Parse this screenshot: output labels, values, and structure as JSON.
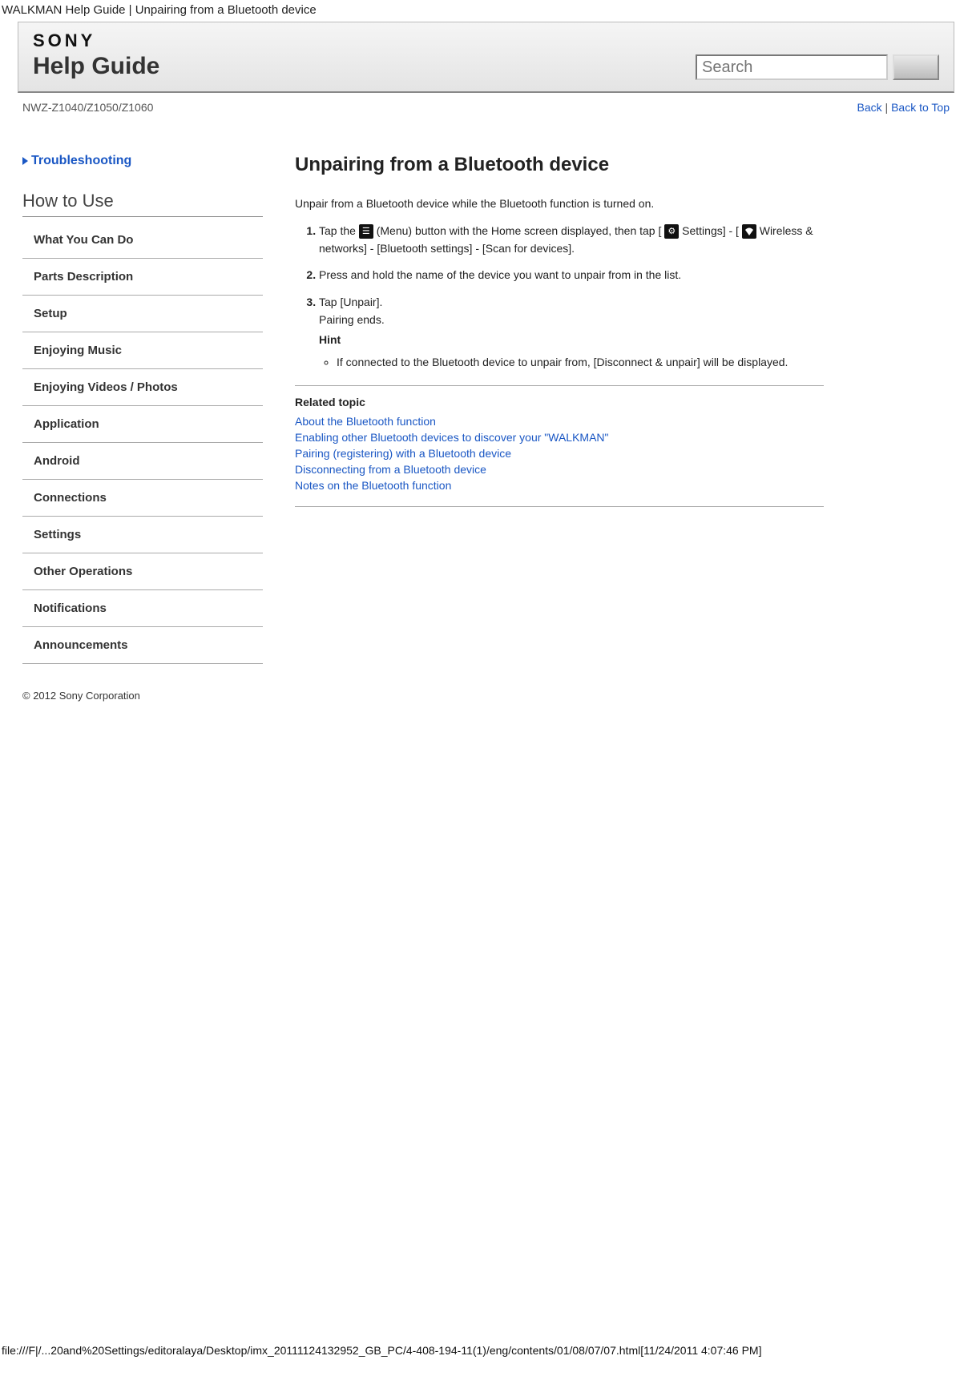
{
  "tab_title": "WALKMAN Help Guide | Unpairing from a Bluetooth device",
  "header": {
    "logo_text": "SONY",
    "title": "Help Guide",
    "search_placeholder": "Search"
  },
  "subbar": {
    "model": "NWZ-Z1040/Z1050/Z1060",
    "back": "Back",
    "back_to_top": "Back to Top",
    "separator": " | "
  },
  "sidebar": {
    "troubleshooting": "Troubleshooting",
    "how_to_use": "How to Use",
    "items": [
      "What You Can Do",
      "Parts Description",
      "Setup",
      "Enjoying Music",
      "Enjoying Videos / Photos",
      "Application",
      "Android",
      "Connections",
      "Settings",
      "Other Operations",
      "Notifications",
      "Announcements"
    ]
  },
  "main": {
    "title": "Unpairing from a Bluetooth device",
    "intro": "Unpair from a Bluetooth device while the Bluetooth function is turned on.",
    "step1_a": "Tap the ",
    "step1_menu_label": "(Menu) button with the Home screen displayed, then tap [",
    "step1_settings": " Settings] - [",
    "step1_wireless": " Wireless & networks] - [Bluetooth settings] - [Scan for devices].",
    "step2": "Press and hold the name of the device you want to unpair from in the list.",
    "step3_a": "Tap [Unpair].",
    "step3_b": "Pairing ends.",
    "hint_label": "Hint",
    "hint_item": "If connected to the Bluetooth device to unpair from, [Disconnect & unpair] will be displayed.",
    "related_title": "Related topic",
    "related": [
      "About the Bluetooth function",
      "Enabling other Bluetooth devices to discover your \"WALKMAN\"",
      "Pairing (registering) with a Bluetooth device",
      "Disconnecting from a Bluetooth device",
      "Notes on the Bluetooth function"
    ]
  },
  "copyright": "© 2012 Sony Corporation",
  "footer_url": "file:///F|/...20and%20Settings/editoralaya/Desktop/imx_20111124132952_GB_PC/4-408-194-11(1)/eng/contents/01/08/07/07.html[11/24/2011 4:07:46 PM]"
}
